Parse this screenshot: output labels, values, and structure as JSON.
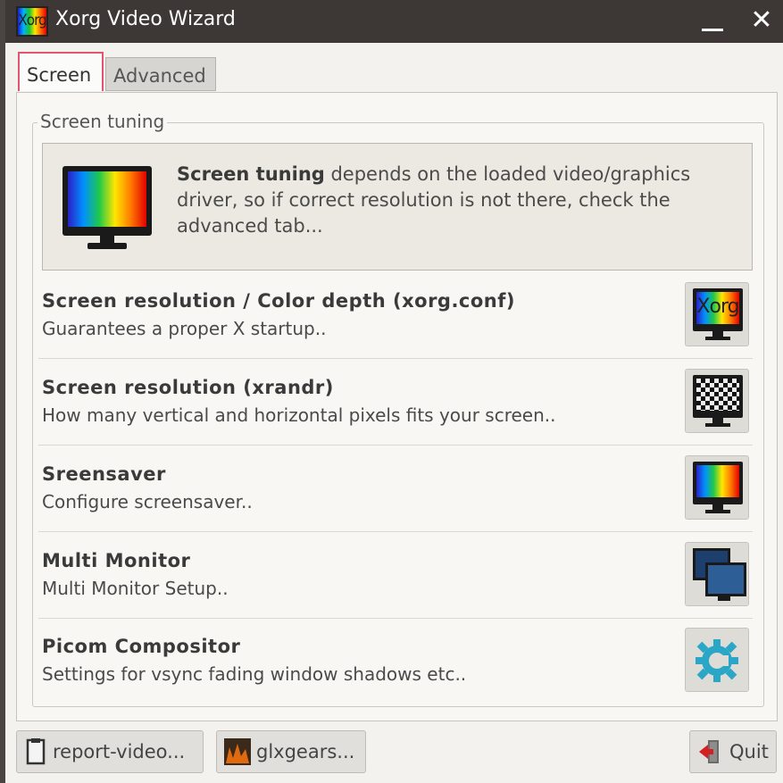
{
  "window": {
    "title": "Xorg Video Wizard",
    "app_icon_text": "Xorg",
    "close_glyph": "✕"
  },
  "tabs": [
    {
      "label": "Screen",
      "active": true
    },
    {
      "label": "Advanced",
      "active": false
    }
  ],
  "screen_tab": {
    "frame_label": "Screen tuning",
    "info": {
      "bold": "Screen tuning",
      "text": " depends on the loaded video/graphics driver, so if correct resolution is not there, check the advanced tab..."
    },
    "rows": [
      {
        "title": "Screen resolution / Color depth (xorg.conf)",
        "description": "Guarantees a proper X startup..",
        "icon": "xorg-monitor-icon",
        "icon_text": "Xorg"
      },
      {
        "title": "Screen resolution (xrandr)",
        "description": "How many vertical and horizontal pixels fits your screen..",
        "icon": "xrandr-monitor-icon"
      },
      {
        "title": "Sreensaver",
        "description": "Configure screensaver..",
        "icon": "screensaver-monitor-icon"
      },
      {
        "title": "Multi Monitor",
        "description": "Multi Monitor Setup..",
        "icon": "multi-monitor-icon"
      },
      {
        "title": "Picom Compositor",
        "description": "Settings for vsync fading window shadows etc..",
        "icon": "picom-gear-icon"
      }
    ]
  },
  "bottom_buttons": {
    "report": "report-video...",
    "glxgears": "glxgears...",
    "quit": "Quit"
  },
  "colors": {
    "titlebar": "#3d3735",
    "tab_active_border": "#e05570",
    "picom_accent": "#2aa6c7"
  }
}
